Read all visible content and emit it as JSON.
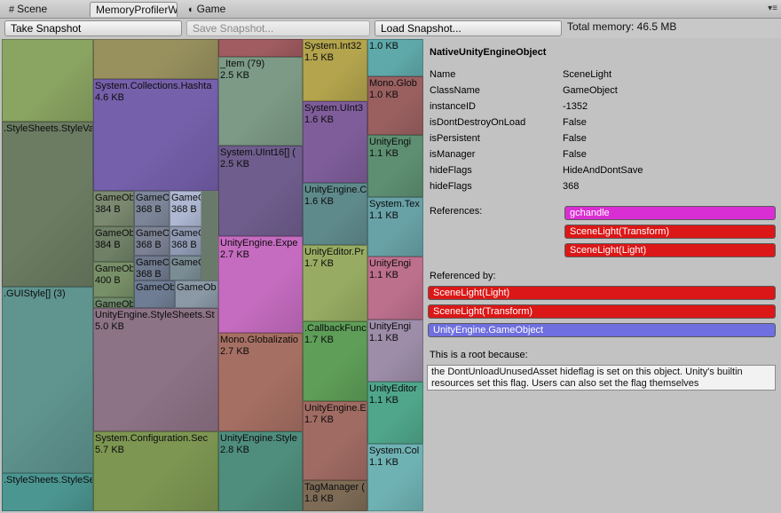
{
  "tabs": [
    {
      "label": "Scene",
      "icon": "grid-icon"
    },
    {
      "label": "MemoryProfilerW",
      "icon": ""
    },
    {
      "label": "Game",
      "icon": "pacman-icon"
    }
  ],
  "toolbar": {
    "take_snapshot": "Take Snapshot",
    "save_snapshot": "Save Snapshot...",
    "load_snapshot": "Load Snapshot...",
    "total_memory": "Total memory: 46.5 MB"
  },
  "treemap": [
    {
      "label": "",
      "size": "",
      "color": "#8aa462"
    },
    {
      "label": ".StyleSheets.StyleVa",
      "size": "",
      "color": "#6b7c62"
    },
    {
      "label": ".GUIStyle[] (3)",
      "size": "",
      "color": "#5f948f"
    },
    {
      "label": ".StyleSheets.StyleSe",
      "size": "",
      "color": "#4c9691"
    },
    {
      "label": "",
      "size": "",
      "color": "#98915e"
    },
    {
      "label": "System.Collections.Hashta",
      "size": "4.6 KB",
      "color": "#7560ab"
    },
    {
      "label": "GameOb",
      "size": "384 B",
      "color": "#7b8970"
    },
    {
      "label": "GameO",
      "size": "368 B",
      "color": "#7c8698"
    },
    {
      "label": "GameO",
      "size": "368 B",
      "color": "#aeb8d2"
    },
    {
      "label": "GameOb",
      "size": "384 B",
      "color": "#6f8067"
    },
    {
      "label": "GameO",
      "size": "368 B",
      "color": "#7c8294"
    },
    {
      "label": "GameO",
      "size": "368 B",
      "color": "#8f9ab2"
    },
    {
      "label": "GameOb",
      "size": "400 B",
      "color": "#789068"
    },
    {
      "label": "GameO",
      "size": "368 B",
      "color": "#707a8e"
    },
    {
      "label": "GameObje",
      "size": "",
      "color": "#7a8c94"
    },
    {
      "label": "GameOb",
      "size": "400 B",
      "color": "#6e8a6a"
    },
    {
      "label": "GameOb",
      "size": "",
      "color": "#6f7d94"
    },
    {
      "label": "GameOb",
      "size": "",
      "color": "#8a99a5"
    },
    {
      "label": "UnityEngine.StyleSheets.St",
      "size": "5.0 KB",
      "color": "#8d7386"
    },
    {
      "label": "System.Configuration.Sec",
      "size": "5.7 KB",
      "color": "#7d9652"
    },
    {
      "label": "",
      "size": "",
      "color": "#a05c61"
    },
    {
      "label": "_Item (79)",
      "size": "2.5 KB",
      "color": "#7c9a85"
    },
    {
      "label": "System.UInt16[] (",
      "size": "2.5 KB",
      "color": "#6f5d8d"
    },
    {
      "label": "UnityEngine.Expe",
      "size": "2.7 KB",
      "color": "#c56cc0"
    },
    {
      "label": "Mono.Globalizatio",
      "size": "2.7 KB",
      "color": "#a66f63"
    },
    {
      "label": "UnityEngine.Style",
      "size": "2.8 KB",
      "color": "#4f8d7c"
    },
    {
      "label": "System.Int32",
      "size": "1.5 KB",
      "color": "#b3a44d"
    },
    {
      "label": "System.UInt3",
      "size": "1.6 KB",
      "color": "#7f5d9a"
    },
    {
      "label": "UnityEngine.C",
      "size": "1.6 KB",
      "color": "#5f8a8c"
    },
    {
      "label": "UnityEditor.Pr",
      "size": "1.7 KB",
      "color": "#97ac62"
    },
    {
      "label": ".CallbackFunc",
      "size": "1.7 KB",
      "color": "#5e9e58"
    },
    {
      "label": "UnityEngine.E",
      "size": "1.7 KB",
      "color": "#a06b63"
    },
    {
      "label": "TagManager (",
      "size": "1.8 KB",
      "color": "#7d6b56"
    },
    {
      "label": "",
      "size": "1.0 KB",
      "color": "#5fa9aa"
    },
    {
      "label": "Mono.Glob",
      "size": "1.0 KB",
      "color": "#9a6060"
    },
    {
      "label": "UnityEngi",
      "size": "1.1 KB",
      "color": "#5e8f72"
    },
    {
      "label": "System.Tex",
      "size": "1.1 KB",
      "color": "#68a1a6"
    },
    {
      "label": "UnityEngi",
      "size": "1.1 KB",
      "color": "#bd708c"
    },
    {
      "label": "UnityEngi",
      "size": "1.1 KB",
      "color": "#9d8da8"
    },
    {
      "label": "UnityEditor",
      "size": "1.1 KB",
      "color": "#4fa68a"
    },
    {
      "label": "System.Col",
      "size": "1.1 KB",
      "color": "#6fb2b4"
    },
    {
      "label": "",
      "size": "",
      "color": "#a7659e"
    }
  ],
  "details": {
    "title": "NativeUnityEngineObject",
    "properties": [
      {
        "label": "Name",
        "value": "SceneLight"
      },
      {
        "label": "ClassName",
        "value": "GameObject"
      },
      {
        "label": "instanceID",
        "value": "-1352"
      },
      {
        "label": "isDontDestroyOnLoad",
        "value": "False"
      },
      {
        "label": "isPersistent",
        "value": "False"
      },
      {
        "label": "isManager",
        "value": "False"
      },
      {
        "label": "hideFlags",
        "value": "HideAndDontSave"
      },
      {
        "label": "hideFlags",
        "value": "368"
      }
    ],
    "references_label": "References:",
    "references": [
      {
        "label": "gchandle",
        "color": "#d92ed3"
      },
      {
        "label": "SceneLight(Transform)",
        "color": "#dc1717"
      },
      {
        "label": "SceneLight(Light)",
        "color": "#dc1717"
      }
    ],
    "referenced_by_label": "Referenced by:",
    "referenced_by": [
      {
        "label": "SceneLight(Light)",
        "color": "#dc1717"
      },
      {
        "label": "SceneLight(Transform)",
        "color": "#dc1717"
      },
      {
        "label": "UnityEngine.GameObject",
        "color": "#6f6fe0"
      }
    ],
    "root_label": "This is a root because:",
    "root_reason": "the DontUnloadUnusedAsset hideflag is set on this object. Unity's builtin resources set this flag. Users can also set the flag themselves"
  }
}
